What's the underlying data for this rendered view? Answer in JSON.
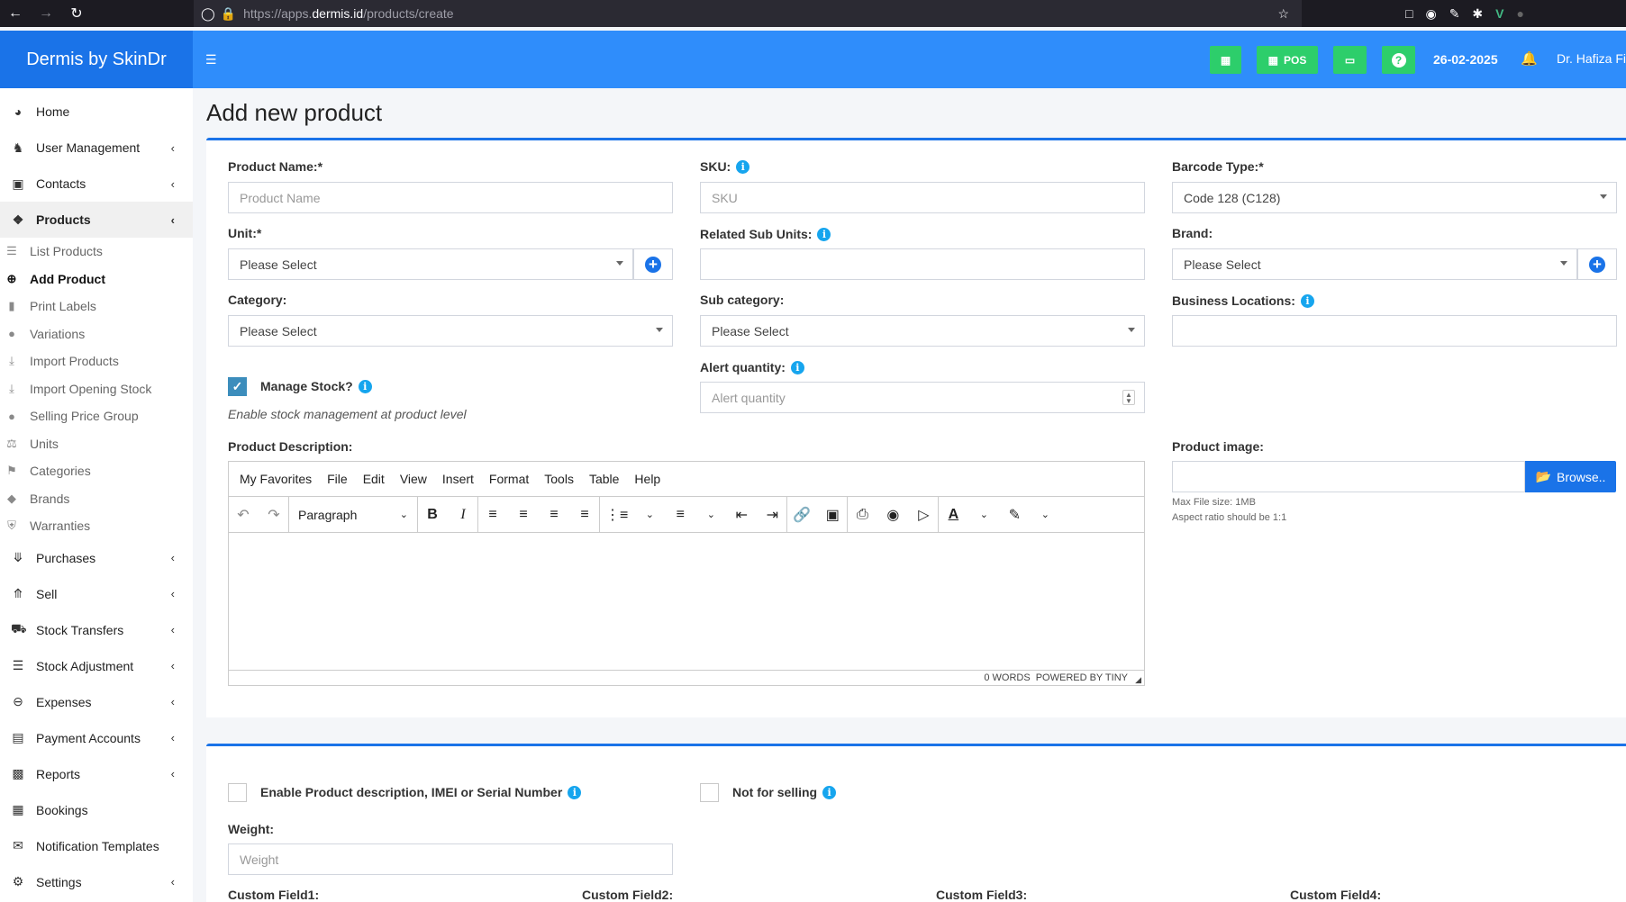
{
  "browser": {
    "url_prefix": "https://apps.",
    "url_domain": "dermis.id",
    "url_path": "/products/create"
  },
  "app": {
    "brand": "Dermis by SkinDr",
    "pos_label": "POS",
    "date": "26-02-2025",
    "user": "Dr. Hafiza Fi"
  },
  "sidebar": {
    "items": [
      {
        "label": "Home",
        "icon": "dashboard-icon"
      },
      {
        "label": "User Management",
        "icon": "users-icon"
      },
      {
        "label": "Contacts",
        "icon": "address-book-icon"
      },
      {
        "label": "Products",
        "icon": "cubes-icon"
      },
      {
        "label": "Purchases",
        "icon": "arrow-circle-down-icon"
      },
      {
        "label": "Sell",
        "icon": "arrow-circle-up-icon"
      },
      {
        "label": "Stock Transfers",
        "icon": "truck-icon"
      },
      {
        "label": "Stock Adjustment",
        "icon": "database-icon"
      },
      {
        "label": "Expenses",
        "icon": "minus-circle-icon"
      },
      {
        "label": "Payment Accounts",
        "icon": "money-check-icon"
      },
      {
        "label": "Reports",
        "icon": "bar-chart-icon"
      },
      {
        "label": "Bookings",
        "icon": "calendar-check-icon"
      },
      {
        "label": "Notification Templates",
        "icon": "envelope-icon"
      },
      {
        "label": "Settings",
        "icon": "cog-icon"
      }
    ],
    "product_sub": [
      {
        "label": "List Products",
        "icon": "list-icon"
      },
      {
        "label": "Add Product",
        "icon": "plus-circle-icon"
      },
      {
        "label": "Print Labels",
        "icon": "barcode-icon"
      },
      {
        "label": "Variations",
        "icon": "circle-icon"
      },
      {
        "label": "Import Products",
        "icon": "download-icon"
      },
      {
        "label": "Import Opening Stock",
        "icon": "download-icon"
      },
      {
        "label": "Selling Price Group",
        "icon": "circle-icon"
      },
      {
        "label": "Units",
        "icon": "balance-scale-icon"
      },
      {
        "label": "Categories",
        "icon": "tags-icon"
      },
      {
        "label": "Brands",
        "icon": "gem-icon"
      },
      {
        "label": "Warranties",
        "icon": "shield-icon"
      }
    ]
  },
  "page": {
    "title": "Add new product"
  },
  "form": {
    "product_name_label": "Product Name:*",
    "product_name_placeholder": "Product Name",
    "sku_label": "SKU:",
    "sku_placeholder": "SKU",
    "barcode_type_label": "Barcode Type:*",
    "barcode_type_value": "Code 128 (C128)",
    "unit_label": "Unit:*",
    "unit_value": "Please Select",
    "related_sub_units_label": "Related Sub Units:",
    "brand_label": "Brand:",
    "brand_value": "Please Select",
    "category_label": "Category:",
    "category_value": "Please Select",
    "sub_category_label": "Sub category:",
    "sub_category_value": "Please Select",
    "business_locations_label": "Business Locations:",
    "manage_stock_label": "Manage Stock?",
    "manage_stock_hint": "Enable stock management at product level",
    "alert_quantity_label": "Alert quantity:",
    "alert_quantity_placeholder": "Alert quantity",
    "product_description_label": "Product Description:",
    "product_image_label": "Product image:",
    "browse_label": "Browse..",
    "max_file_size": "Max File size: 1MB",
    "aspect_ratio": "Aspect ratio should be 1:1",
    "enable_imei_label": "Enable Product description, IMEI or Serial Number",
    "not_for_selling_label": "Not for selling",
    "weight_label": "Weight:",
    "weight_placeholder": "Weight",
    "custom_fields": [
      "Custom Field1:",
      "Custom Field2:",
      "Custom Field3:",
      "Custom Field4:"
    ]
  },
  "editor": {
    "menu": [
      "My Favorites",
      "File",
      "Edit",
      "View",
      "Insert",
      "Format",
      "Tools",
      "Table",
      "Help"
    ],
    "block_format": "Paragraph",
    "word_count": "0 WORDS",
    "powered_by": "POWERED BY TINY"
  }
}
